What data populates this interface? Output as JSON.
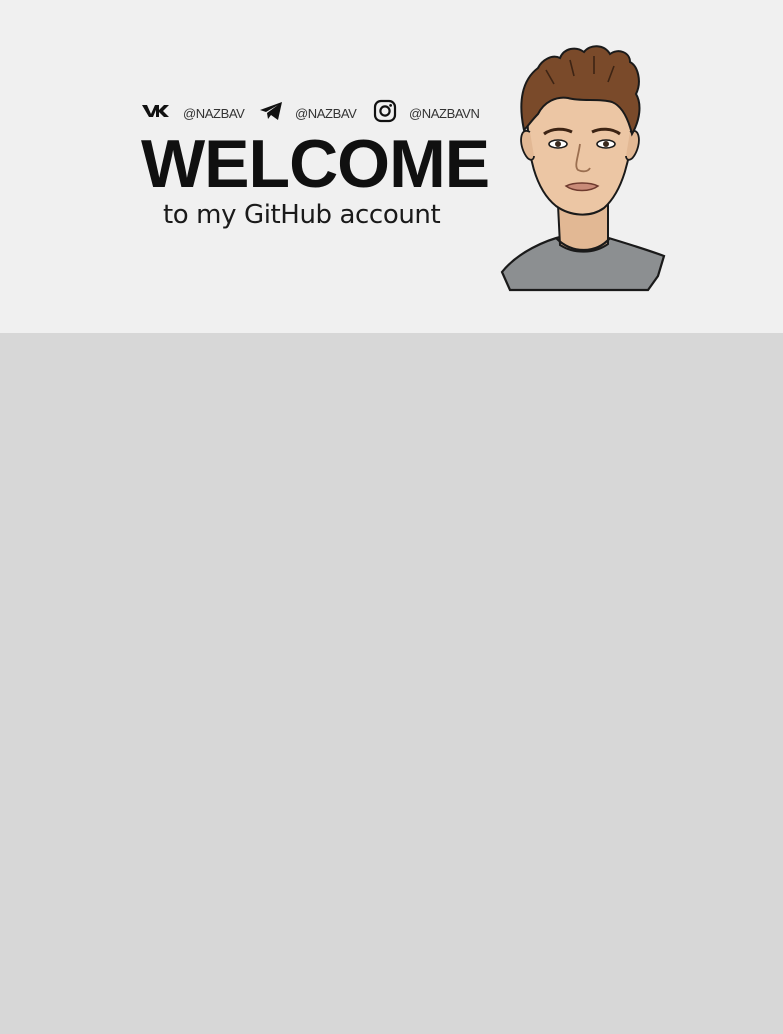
{
  "banner": {
    "socials": [
      {
        "icon": "vk-icon",
        "handle": "@NAZBAV"
      },
      {
        "icon": "telegram-icon",
        "handle": "@NAZBAV"
      },
      {
        "icon": "instagram-icon",
        "handle": "@NAZBAVN"
      }
    ],
    "title": "WELCOME",
    "subtitle": "to my GitHub account",
    "avatar_icon": "avatar-illustration"
  },
  "colors": {
    "banner_bg": "#f0f0f0",
    "page_bg": "#d7d7d7",
    "text_dark": "#101010",
    "shirt": "#8c8f91",
    "hair": "#7a4a2a",
    "skin": "#e9c3a0"
  }
}
